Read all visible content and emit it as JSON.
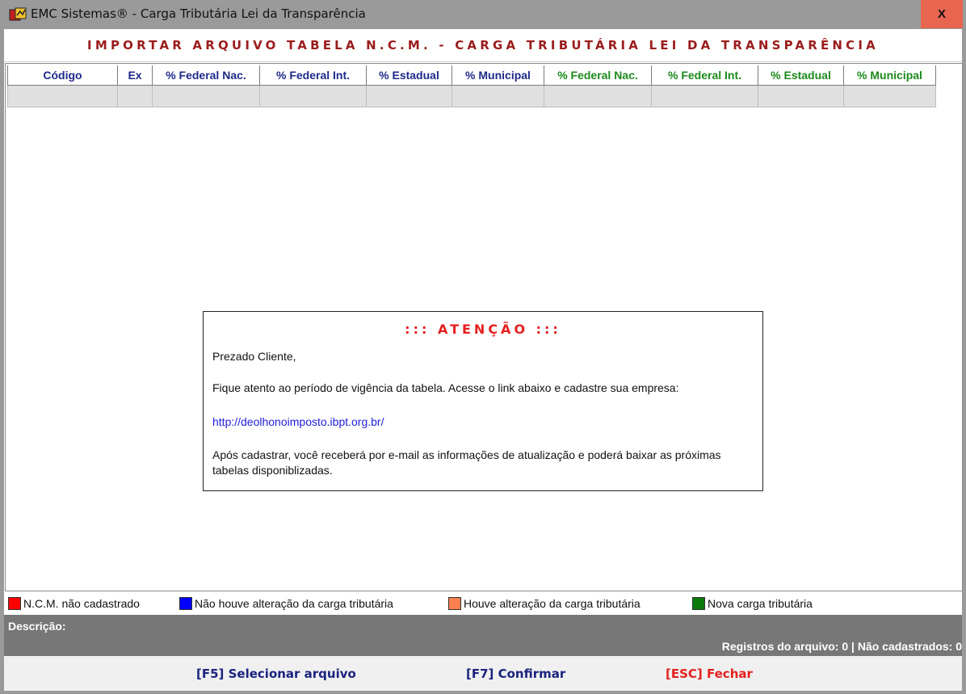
{
  "window": {
    "title": "EMC Sistemas® - Carga Tributária Lei da Transparência",
    "close_label": "X"
  },
  "header": {
    "title": "IMPORTAR ARQUIVO TABELA N.C.M. - CARGA TRIBUTÁRIA LEI DA TRANSPARÊNCIA"
  },
  "grid": {
    "columns": [
      {
        "label": "Código",
        "color": "#1f2a8a"
      },
      {
        "label": "Ex",
        "color": "#1f2a8a"
      },
      {
        "label": "% Federal Nac.",
        "color": "#1f2a8a"
      },
      {
        "label": "% Federal Int.",
        "color": "#1f2a8a"
      },
      {
        "label": "% Estadual",
        "color": "#1f2a8a"
      },
      {
        "label": "% Municipal",
        "color": "#1f2a8a"
      },
      {
        "label": "% Federal Nac.",
        "color": "#1c8a1c"
      },
      {
        "label": "% Federal Int.",
        "color": "#1c8a1c"
      },
      {
        "label": "% Estadual",
        "color": "#1c8a1c"
      },
      {
        "label": "% Municipal",
        "color": "#1c8a1c"
      }
    ]
  },
  "notice": {
    "title": "::: ATENÇÃO :::",
    "greeting": "Prezado Cliente,",
    "line1": "Fique atento ao período de vigência da tabela. Acesse o link abaixo e cadastre sua empresa:",
    "link": "http://deolhonoimposto.ibpt.org.br/",
    "line2": "Após cadastrar, você receberá por e-mail as informações de atualização e poderá baixar as próximas tabelas disponiblizadas."
  },
  "legend": [
    {
      "label": "N.C.M. não cadastrado",
      "color": "#ff0000"
    },
    {
      "label": "Não houve alteração da carga tributária",
      "color": "#0000ff"
    },
    {
      "label": "Houve alteração da carga tributária",
      "color": "#ff7f50"
    },
    {
      "label": "Nova carga tributária",
      "color": "#0a7a0a"
    }
  ],
  "status": {
    "description_label": "Descrição:",
    "counts": "Registros do arquivo: 0 | Não cadastrados: 0"
  },
  "actions": {
    "select_file": "[F5] Selecionar arquivo",
    "confirm": "[F7] Confirmar",
    "close": "[ESC] Fechar"
  }
}
